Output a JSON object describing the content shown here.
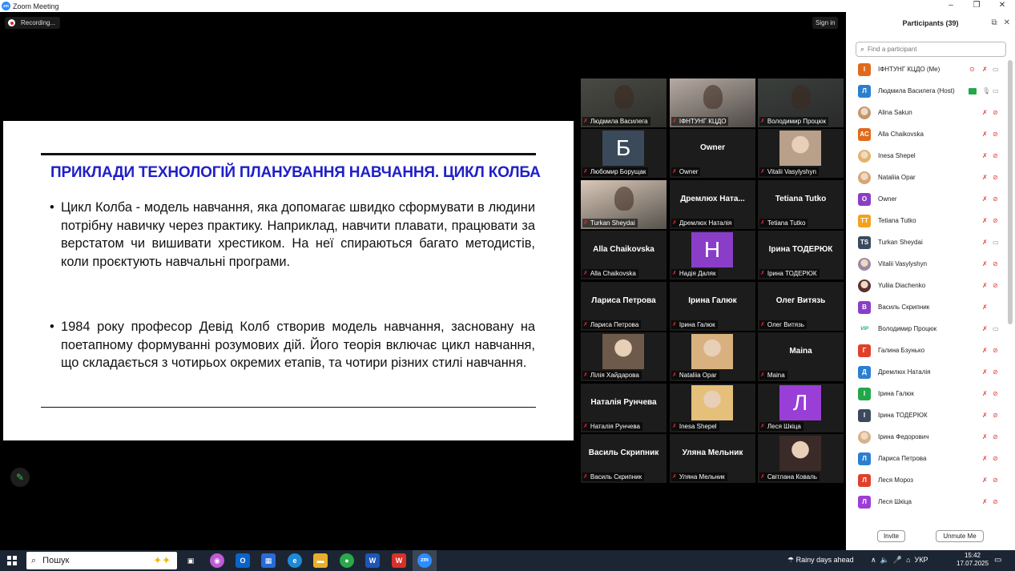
{
  "window": {
    "title": "Zoom Meeting",
    "controls": [
      "–",
      "❐",
      "✕"
    ]
  },
  "topbar": {
    "recording": "Recording...",
    "signin": "Sign in"
  },
  "slide": {
    "title": "ПРИКЛАДИ ТЕХНОЛОГІЙ ПЛАНУВАННЯ НАВЧАННЯ. ЦИКЛ КОЛБА",
    "bullet_char": "•",
    "bullet1": "Цикл Колба - модель навчання, яка допомагає швидко сформувати в людини потрібну навичку через практику. Наприклад, навчити плавати, працювати за верстатом чи вишивати хрестиком. На неї спираються багато методистів, коли проєктують навчальні програми.",
    "bullet2": "1984 року професор Девід Колб створив модель навчання, засновану на поетапному формуванні розумових дій. Його теорія включає цикл навчання, що складається з чотирьох окремих етапів, та чотири різних стилі навчання."
  },
  "gallery": [
    {
      "label": "Людмила Василега",
      "kind": "video",
      "color": "#4a4a44"
    },
    {
      "label": "ІФНТУНГ КЦДО",
      "kind": "video",
      "color": "#b7aaa2"
    },
    {
      "label": "Володимир Процюк",
      "kind": "video",
      "color": "#3b3f3c"
    },
    {
      "label": "Любомир Борущак",
      "kind": "letter",
      "letter": "Б",
      "color": "#3a4a5a"
    },
    {
      "label": "Owner",
      "kind": "name",
      "big": "Owner"
    },
    {
      "label": "Vitalii Vasylyshyn",
      "kind": "photo",
      "color": "#b8a08a"
    },
    {
      "label": "Turkan Sheydai",
      "kind": "video",
      "color": "#d9c8b8"
    },
    {
      "label": "Дремлюх Наталія",
      "kind": "name",
      "big": "Дремлюх  Ната..."
    },
    {
      "label": "Tetiana Tutko",
      "kind": "name",
      "big": "Tetiana Tutko"
    },
    {
      "label": "Alla Chaikovska",
      "kind": "name",
      "big": "Alla Chaikovska"
    },
    {
      "label": "Надія Даляк",
      "kind": "letter",
      "letter": "Н",
      "color": "#8a3ec8"
    },
    {
      "label": "Ірина ТОДЕРЮК",
      "kind": "name",
      "big": "Ірина ТОДЕРЮК"
    },
    {
      "label": "Лариса Петрова",
      "kind": "name",
      "big": "Лариса Петрова"
    },
    {
      "label": "Ірина Галюк",
      "kind": "name",
      "big": "Ірина Галюк"
    },
    {
      "label": "Олег Витязь",
      "kind": "name",
      "big": "Олег Витязь"
    },
    {
      "label": "Лілія Хайдарова",
      "kind": "photo",
      "color": "#6d5a4a"
    },
    {
      "label": "Nataliia Opar",
      "kind": "photo",
      "color": "#d9b17e"
    },
    {
      "label": "Maina",
      "kind": "name",
      "big": "Maina"
    },
    {
      "label": "Наталія Рунчева",
      "kind": "name",
      "big": "Наталія Рунчева"
    },
    {
      "label": "Inesa Shepel",
      "kind": "photo",
      "color": "#e4c07a"
    },
    {
      "label": "Леся Шкіца",
      "kind": "letter",
      "letter": "Л",
      "color": "#9a3ed8"
    },
    {
      "label": "Василь Скрипник",
      "kind": "name",
      "big": "Василь Скрипник"
    },
    {
      "label": "Уляна Мельник",
      "kind": "name",
      "big": "Уляна Мельник"
    },
    {
      "label": "Світлана Коваль",
      "kind": "photo",
      "color": "#3a2a28"
    }
  ],
  "participants": {
    "title": "Participants (39)",
    "search_placeholder": "Find a participant",
    "list": [
      {
        "name": "ІФНТУНГ КЦДО (Me)",
        "initials": "І",
        "color": "#e06a1c",
        "mic": "muted",
        "cam": "on",
        "extra": "rec"
      },
      {
        "name": "Людмила Василега (Host)",
        "initials": "Л",
        "color": "#2c7fd0",
        "mic": "on",
        "cam": "on",
        "extra": "share"
      },
      {
        "name": "Alina Sakun",
        "initials": "",
        "color": "#c4966e",
        "mic": "muted",
        "cam": "off"
      },
      {
        "name": "Alla Chaikovska",
        "initials": "AC",
        "color": "#e06a1c",
        "mic": "muted",
        "cam": "off"
      },
      {
        "name": "Inesa Shepel",
        "initials": "",
        "color": "#e2b468",
        "mic": "muted",
        "cam": "off"
      },
      {
        "name": "Nataliia Opar",
        "initials": "",
        "color": "#d7a676",
        "mic": "muted",
        "cam": "off"
      },
      {
        "name": "Owner",
        "initials": "O",
        "color": "#8a3ec8",
        "mic": "muted",
        "cam": "off"
      },
      {
        "name": "Tetiana Tutko",
        "initials": "TT",
        "color": "#f2a21c",
        "mic": "muted",
        "cam": "off"
      },
      {
        "name": "Turkan Sheydai",
        "initials": "TS",
        "color": "#3b4a5e",
        "mic": "muted",
        "cam": "on"
      },
      {
        "name": "Vitalii Vasylyshyn",
        "initials": "",
        "color": "#9a8aa0",
        "mic": "muted",
        "cam": "off"
      },
      {
        "name": "Yuliia Diachenko",
        "initials": "",
        "color": "#5a3030",
        "mic": "muted",
        "cam": "off"
      },
      {
        "name": "Василь Скрипник",
        "initials": "В",
        "color": "#8a3ec8",
        "mic": "muted",
        "cam": "none"
      },
      {
        "name": "Володимир Процюк",
        "initials": "VIP",
        "color": "#1aa88a",
        "mic": "muted",
        "cam": "on"
      },
      {
        "name": "Галина Бзунько",
        "initials": "Г",
        "color": "#e0402a",
        "mic": "muted",
        "cam": "off"
      },
      {
        "name": "Дремлюх Наталія",
        "initials": "Д",
        "color": "#2c7fd0",
        "mic": "muted",
        "cam": "off"
      },
      {
        "name": "Ірина Галюк",
        "initials": "І",
        "color": "#22a84a",
        "mic": "muted",
        "cam": "off"
      },
      {
        "name": "Ірина ТОДЕРЮК",
        "initials": "І",
        "color": "#3b4a5e",
        "mic": "muted",
        "cam": "off"
      },
      {
        "name": "Ірина Федорович",
        "initials": "",
        "color": "#d6b28a",
        "mic": "muted",
        "cam": "off"
      },
      {
        "name": "Лариса Петрова",
        "initials": "Л",
        "color": "#2c7fd0",
        "mic": "muted",
        "cam": "off"
      },
      {
        "name": "Леся Мороз",
        "initials": "Л",
        "color": "#e0402a",
        "mic": "muted",
        "cam": "off"
      },
      {
        "name": "Леся Шкіца",
        "initials": "Л",
        "color": "#9a3ed8",
        "mic": "muted",
        "cam": "off"
      }
    ],
    "invite": "Invite",
    "unmute": "Unmute Me"
  },
  "taskbar": {
    "search": "Пошук",
    "weather": "Rainy days ahead",
    "lang": "УКР",
    "time": "15:42",
    "date": "17.07.2025"
  },
  "colors": {
    "accent": "#2d8cff",
    "slide_title": "#1f1fc8",
    "active_speaker": "#d8e43a",
    "muted": "#e23a3a"
  }
}
